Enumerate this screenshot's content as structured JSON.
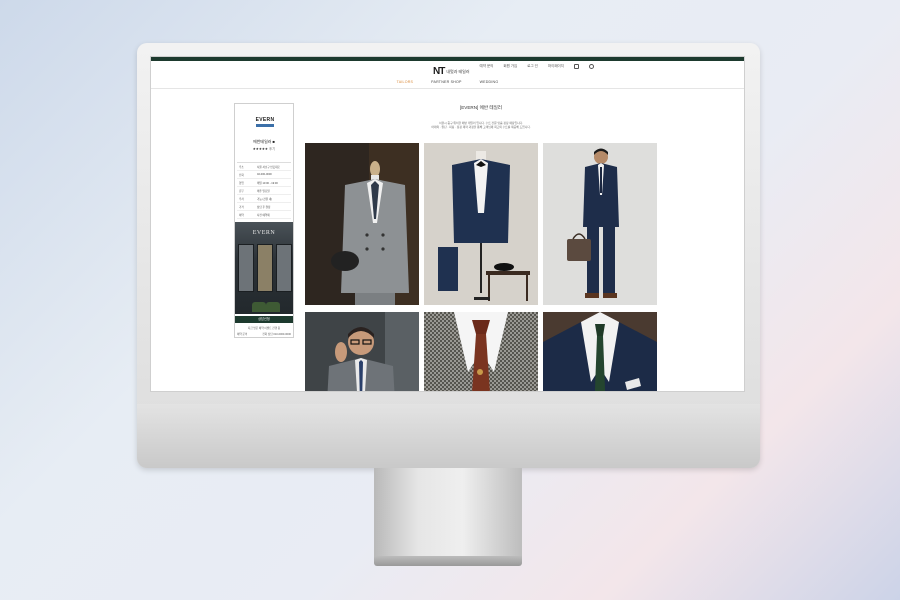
{
  "header": {
    "util_links": [
      "예약 문의",
      "회원 가입",
      "로그 인",
      "마이페이지"
    ],
    "logo_mark": "NT",
    "logo_text": "내멋과 테일러"
  },
  "nav": {
    "items": [
      "TAILORS",
      "PARTNER SHOP",
      "WEDDING"
    ],
    "active_index": 0
  },
  "sidebar": {
    "brand_logo": "EVERN",
    "shop_name": "에반테일러 ■",
    "rating_stars": "★★★★★",
    "rating_count": "후기",
    "info_rows": [
      {
        "key": "주소",
        "value": "서울 서초구 반포대로"
      },
      {
        "key": "전화",
        "value": "02-000-0000"
      },
      {
        "key": "영업",
        "value": "매일 10:00 - 19:00"
      },
      {
        "key": "휴무",
        "value": "매주 일요일"
      },
      {
        "key": "주차",
        "value": "가능 (건물 내)"
      },
      {
        "key": "가격",
        "value": "상담 후 결정"
      },
      {
        "key": "예약",
        "value": "사전 예약제"
      }
    ],
    "storefront_sign": "EVERN",
    "consult_button": "상담신청",
    "notice": "지금 방문 예약 이벤트 진행 중",
    "contact_left": "예약 문의",
    "contact_right": "전화 상담 010-0000-0000"
  },
  "content": {
    "title": "[EVERN] 에반 테일러",
    "description_line1": "서울시 중구 위치한 에반 테일러 입니다. 수트 전문 맞춤 정장 매장입니다.",
    "description_line2": "아래의 · 원단 · 피팅 · 정장 제작 과정을 통해 고객님께 최고의 수트를 제공해 드립니다.",
    "photos": [
      {
        "name": "grey-double-breasted-suit"
      },
      {
        "name": "navy-tuxedo-on-stand"
      },
      {
        "name": "man-in-navy-suit-with-bag"
      },
      {
        "name": "man-in-grey-suit-glasses"
      },
      {
        "name": "houndstooth-jacket-paisley-tie"
      },
      {
        "name": "navy-suit-green-tie"
      }
    ]
  },
  "colors": {
    "brand_green": "#1d3a2e",
    "nav_active": "#d98a3a",
    "accent_blue": "#3b6fa8"
  }
}
